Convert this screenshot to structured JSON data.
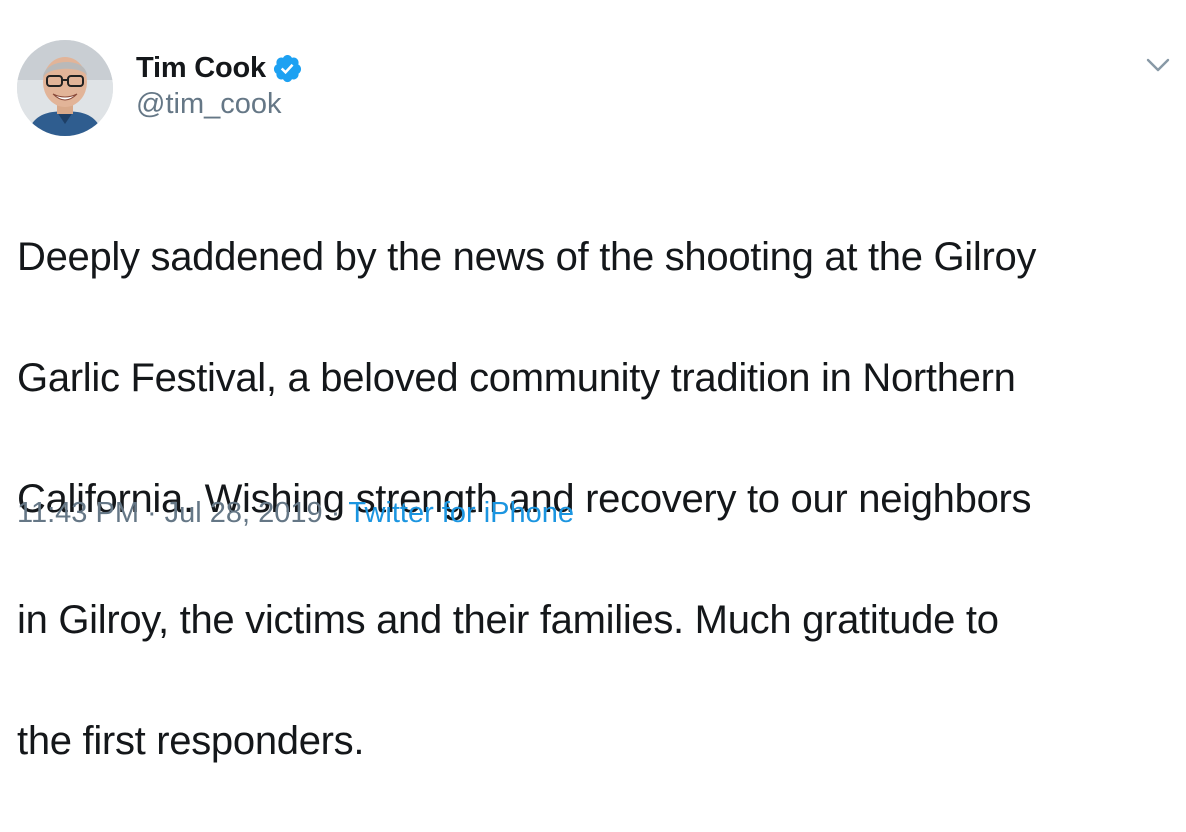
{
  "author": {
    "name": "Tim Cook",
    "handle": "@tim_cook",
    "verified": true,
    "avatar_icon": "profile-photo"
  },
  "tweet": {
    "text_lines": [
      "Deeply saddened by the news of the shooting at the Gilroy",
      "Garlic Festival, a beloved community tradition in Northern",
      "California. Wishing strength and recovery to our neighbors",
      "in Gilroy, the victims and their families. Much gratitude to",
      "the first responders."
    ]
  },
  "meta": {
    "time": "11:43 PM",
    "separator": "·",
    "date": "Jul 28, 2019",
    "source": "Twitter for iPhone"
  },
  "colors": {
    "text": "#14171a",
    "muted": "#657786",
    "link": "#1b95e0",
    "verified": "#1da1f2"
  },
  "icons": {
    "verified": "verified-badge-icon",
    "menu": "chevron-down-icon"
  }
}
